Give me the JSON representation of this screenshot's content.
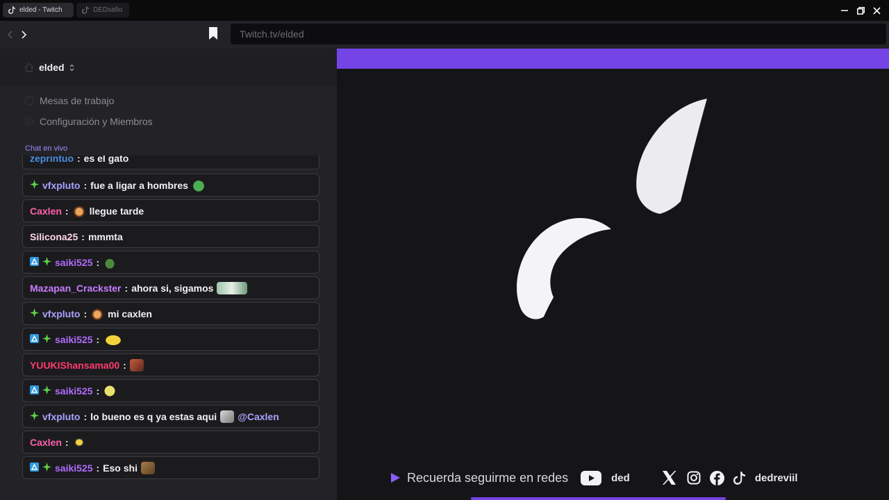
{
  "browser": {
    "tabs": [
      {
        "label": "elded - Twitch",
        "active": true
      },
      {
        "label": "DEDsafio",
        "active": false
      }
    ],
    "url": "Twitch.tv/elded"
  },
  "sidebar": {
    "workspace_name": "elded",
    "nav_items": [
      {
        "label": "Mesas de trabajo",
        "icon": "home-icon"
      },
      {
        "label": "Configuración y Miembros",
        "icon": "gear-icon"
      }
    ],
    "chat_label": "Chat en vivo"
  },
  "chat": {
    "messages": [
      {
        "user": "zeprintuo",
        "color": "#4a90e2",
        "badges": [],
        "text": "es el gato",
        "partial": true
      },
      {
        "user": "vfxpluto",
        "color": "#a9a3ff",
        "badges": [
          "green"
        ],
        "text": "fue a ligar a hombres",
        "emote_after": "frog"
      },
      {
        "user": "Caxlen",
        "color": "#ff5fae",
        "badges": [],
        "emote_before": "face",
        "text": "llegue tarde"
      },
      {
        "user": "Silicona25",
        "color": "#ffd6e8",
        "badges": [],
        "text": "mmmta"
      },
      {
        "user": "saiki525",
        "color": "#b06cff",
        "badges": [
          "blue",
          "green"
        ],
        "text": "",
        "emote_after": "leaf"
      },
      {
        "user": "Mazapan_Crackster",
        "color": "#c77dff",
        "badges": [],
        "text": "ahora si, sigamos",
        "emote_after": "pic"
      },
      {
        "user": "vfxpluto",
        "color": "#a9a3ff",
        "badges": [
          "green"
        ],
        "emote_before": "face",
        "text": "mi caxlen"
      },
      {
        "user": "saiki525",
        "color": "#b06cff",
        "badges": [
          "blue",
          "green"
        ],
        "text": "",
        "emote_after": "yellow2"
      },
      {
        "user": "YUUKIShansama00",
        "color": "#ff3b6b",
        "badges": [],
        "text": "",
        "emote_after": "brown"
      },
      {
        "user": "saiki525",
        "color": "#b06cff",
        "badges": [
          "blue",
          "green"
        ],
        "text": "",
        "emote_after": "yellow"
      },
      {
        "user": "vfxpluto",
        "color": "#a9a3ff",
        "badges": [
          "green"
        ],
        "text": "lo bueno es q ya estas aqui",
        "emote_after": "gray",
        "mention": "@Caxlen"
      },
      {
        "user": "Caxlen",
        "color": "#ff5fae",
        "badges": [],
        "text": "",
        "emote_after": "bee"
      },
      {
        "user": "saiki525",
        "color": "#b06cff",
        "badges": [
          "blue",
          "green"
        ],
        "text": "Eso shi",
        "emote_after": "box"
      }
    ]
  },
  "stream": {
    "footer_text": "Recuerda seguirme en redes",
    "youtube_handle": "ded",
    "social_handle": "dedreviil",
    "accent": "#7544e6",
    "progress_fraction": 0.46
  }
}
